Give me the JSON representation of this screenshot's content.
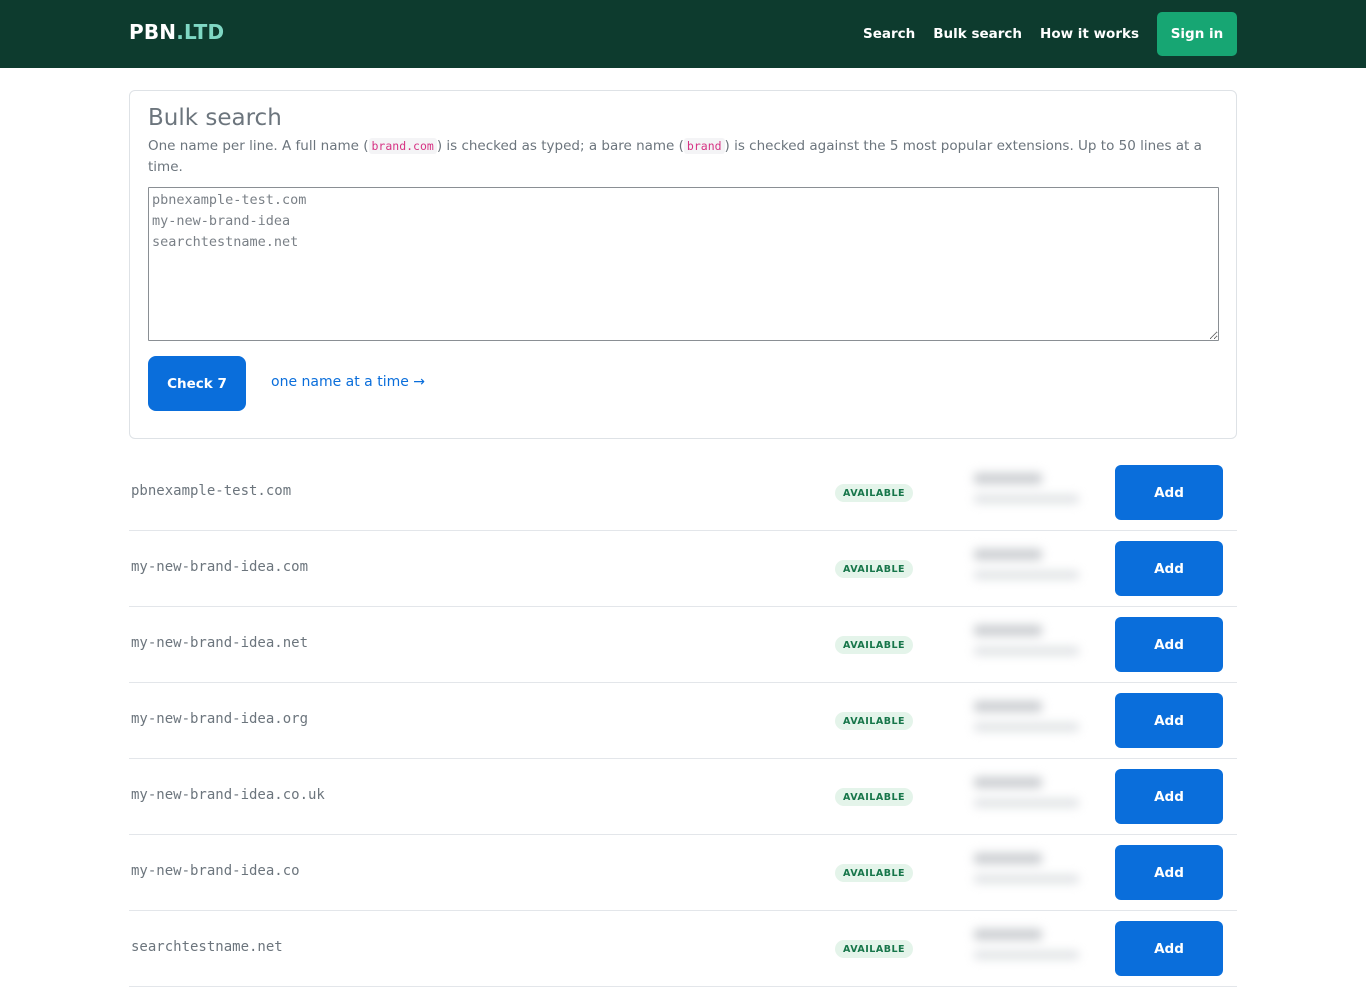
{
  "nav": {
    "brand_main": "PBN",
    "brand_tld": ".LTD",
    "links": [
      "Search",
      "Bulk search",
      "How it works"
    ],
    "signin_label": "Sign in",
    "background": "#0d3b2e",
    "signin_color": "#17a673"
  },
  "bulk": {
    "title": "Bulk search",
    "desc_part1": "One name per line. A full name (",
    "desc_code1": "brand.com",
    "desc_part2": ") is checked as typed; a bare name (",
    "desc_code2": "brand",
    "desc_part3": ") is checked against the 5 most popular extensions. Up to 50 lines at a time.",
    "textarea_placeholder": "pbnexample-test.com\nmy-new-brand-idea\nsearchtestname.net",
    "textarea_value": "",
    "check_label": "Check 7",
    "single_link": "one name at a time →",
    "accent": "#0a6edb"
  },
  "results": [
    {
      "domain": "pbnexample-test.com",
      "status": "AVAILABLE",
      "action": "Add"
    },
    {
      "domain": "my-new-brand-idea.com",
      "status": "AVAILABLE",
      "action": "Add"
    },
    {
      "domain": "my-new-brand-idea.net",
      "status": "AVAILABLE",
      "action": "Add"
    },
    {
      "domain": "my-new-brand-idea.org",
      "status": "AVAILABLE",
      "action": "Add"
    },
    {
      "domain": "my-new-brand-idea.co.uk",
      "status": "AVAILABLE",
      "action": "Add"
    },
    {
      "domain": "my-new-brand-idea.co",
      "status": "AVAILABLE",
      "action": "Add"
    },
    {
      "domain": "searchtestname.net",
      "status": "AVAILABLE",
      "action": "Add"
    }
  ]
}
